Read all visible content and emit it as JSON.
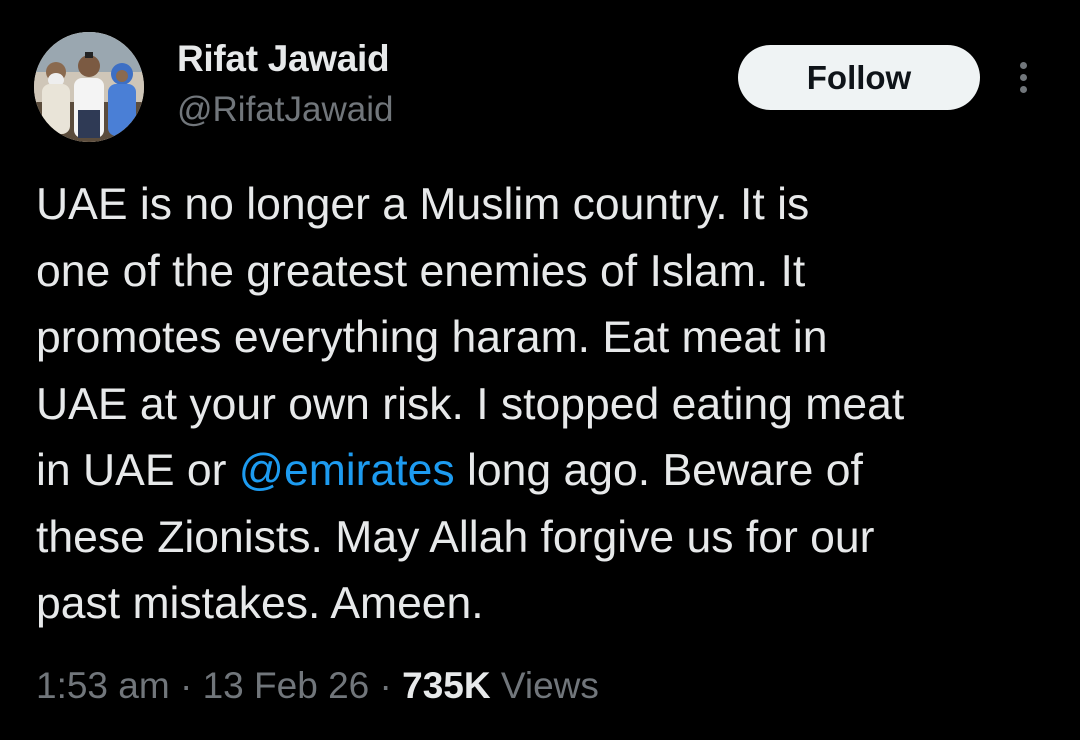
{
  "author": {
    "display_name": "Rifat Jawaid",
    "handle": "@RifatJawaid"
  },
  "actions": {
    "follow_label": "Follow",
    "more_icon": "more-vertical-icon"
  },
  "tweet": {
    "lines": [
      {
        "text": "UAE is no longer a Muslim country. It is"
      },
      {
        "text": "one of the greatest enemies of Islam. It"
      },
      {
        "text": "promotes everything haram. Eat meat in"
      },
      {
        "text": "UAE at your own risk. I stopped eating meat"
      },
      {
        "before": "in UAE or ",
        "mention": "@emirates",
        "after": " long ago. Beware of"
      },
      {
        "text": "these Zionists. May Allah forgive us for our"
      },
      {
        "text": "past mistakes. Ameen."
      }
    ]
  },
  "meta": {
    "time": "1:53 am",
    "separator": " · ",
    "date": "13 Feb 26",
    "views_count": "735K",
    "views_label": " Views"
  },
  "colors": {
    "background": "#000000",
    "text": "#e7e9ea",
    "secondary": "#71767b",
    "link": "#1d9bf0",
    "follow_bg": "#eff3f4"
  }
}
